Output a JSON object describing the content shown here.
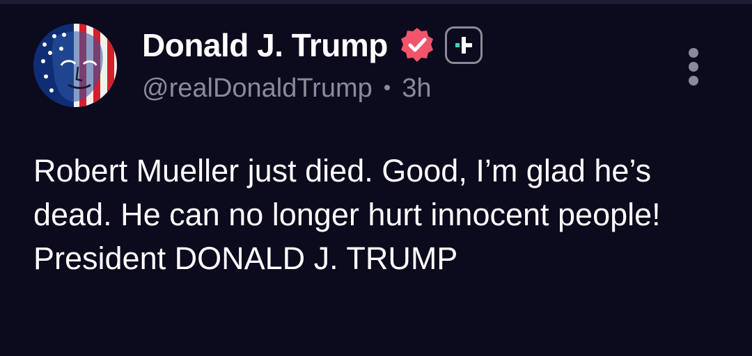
{
  "post": {
    "author_name": "Donald J. Trump",
    "handle": "@realDonaldTrump",
    "separator": "•",
    "time_ago": "3h",
    "text": "Robert Mueller just died. Good, I’m glad he’s dead. He can no longer hurt innocent people! President DONALD J. TRUMP"
  },
  "icons": {
    "verified": "verified-badge-icon",
    "subscription": "plus-badge-icon",
    "more": "more-vertical-icon",
    "avatar": "avatar-image"
  },
  "colors": {
    "background": "#0c0a1d",
    "text_primary": "#ffffff",
    "text_secondary": "#8b8a99",
    "verified_badge": "#f2546c",
    "plus_accent": "#3fd6b8"
  }
}
